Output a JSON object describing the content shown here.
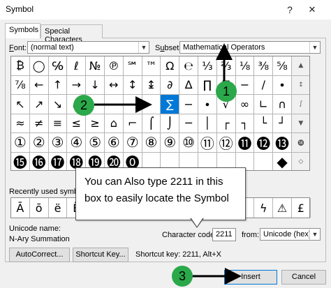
{
  "window": {
    "title": "Symbol",
    "help": "?",
    "close": "✕"
  },
  "tabs": [
    {
      "label": "Symbols"
    },
    {
      "label": "Special Characters"
    }
  ],
  "font": {
    "label_prefix": "F",
    "label_rest": "ont:",
    "value": "(normal text)"
  },
  "subset": {
    "label_prefix": "",
    "label_u": "u",
    "label_start": "S",
    "label_rest": "bset:",
    "value": "Mathematical Operators"
  },
  "grid": {
    "rows": [
      [
        "₿",
        "◯",
        "℅",
        "ℓ",
        "№",
        "℗",
        "℠",
        "™",
        "Ω",
        "℮",
        "⅓",
        "⅔",
        "⅛",
        "⅜",
        "⅝",
        "▲"
      ],
      [
        "⅞",
        "←",
        "↑",
        "→",
        "↓",
        "↔",
        "↕",
        "↨",
        "∂",
        "∆",
        "∏",
        "∑",
        "−",
        "∕",
        "∙",
        "↕"
      ],
      [
        "↖",
        "↗",
        "↘",
        "↙",
        "",
        "",
        "",
        "",
        "∑",
        "−",
        "∙",
        "√",
        "∞",
        "∟",
        "∩",
        "∫"
      ],
      [
        "≈",
        "≠",
        "≡",
        "≤",
        "≥",
        "⌂",
        "⌐",
        "⌠",
        "⌡",
        "─",
        "│",
        "┌",
        "┐",
        "└",
        "┘",
        "▼"
      ],
      [
        "①",
        "②",
        "③",
        "④",
        "⑤",
        "⑥",
        "⑦",
        "⑧",
        "⑨",
        "⑩",
        "⑪",
        "⑫",
        "⓫",
        "⓬",
        "⓭",
        "⓮"
      ],
      [
        "⓯",
        "⓰",
        "⓱",
        "⓲",
        "⓳",
        "⓴",
        "⓿",
        "",
        "",
        "",
        "",
        "",
        "",
        "",
        "◆",
        "◇"
      ]
    ]
  },
  "recent": {
    "label": "Recently used symbols:",
    "symbols": [
      "Ā",
      "ō",
      "ë",
      "Ë",
      "",
      "",
      "",
      "",
      "",
      "",
      "",
      "",
      "",
      "ϟ",
      "⚠",
      "£"
    ]
  },
  "unicode": {
    "label": "Unicode name:",
    "name": "N-Ary Summation"
  },
  "charcode": {
    "label": "Character code:",
    "value": "2211",
    "from_label": "from:",
    "from_value": "Unicode (hex)"
  },
  "buttons": {
    "autocorrect": "AutoCorrect...",
    "shortcut_key": "Shortcut Key...",
    "insert": "Insert",
    "cancel": "Cancel"
  },
  "shortcut": {
    "text": "Shortcut key: 2211, Alt+X"
  },
  "callout": {
    "text": "You can Also type 2211 in this box to easily locate the Symbol"
  },
  "badges": {
    "one": "1",
    "two": "2",
    "three": "3"
  },
  "colors": {
    "accent": "#0078d7",
    "badge": "#2aa84a"
  }
}
